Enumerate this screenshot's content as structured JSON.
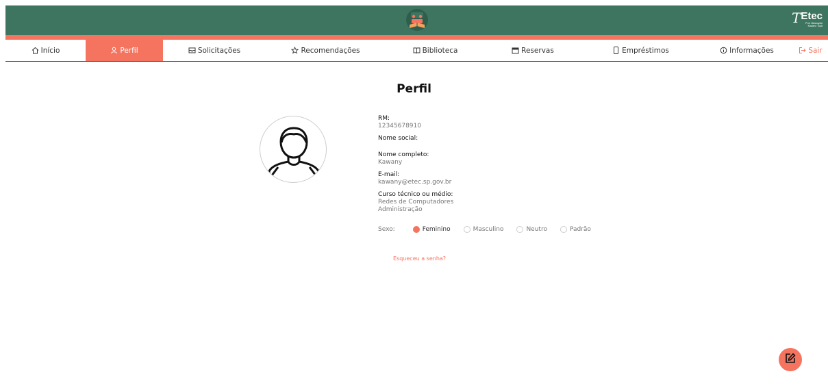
{
  "header": {
    "logo_icon": "library-logo-icon",
    "brand": {
      "mark": "T",
      "name": "Etec",
      "sub1": "Prof. Massuyuki",
      "sub2": "Kawano Tupã"
    }
  },
  "colors": {
    "primary": "#3e7560",
    "accent": "#f5745f"
  },
  "nav": {
    "items": [
      {
        "label": "Início",
        "icon": "home-icon"
      },
      {
        "label": "Perfil",
        "icon": "user-icon",
        "active": true
      },
      {
        "label": "Solicitações",
        "icon": "inbox-icon"
      },
      {
        "label": "Recomendações",
        "icon": "star-icon"
      },
      {
        "label": "Biblioteca",
        "icon": "book-icon"
      },
      {
        "label": "Reservas",
        "icon": "calendar-icon"
      },
      {
        "label": "Empréstimos",
        "icon": "phone-icon"
      },
      {
        "label": "Informações",
        "icon": "info-icon"
      },
      {
        "label": "Sair",
        "icon": "logout-icon"
      }
    ]
  },
  "profile": {
    "title": "Perfil",
    "avatar_icon": "user-avatar-icon",
    "rm_label": "RM:",
    "rm_value": "12345678910",
    "social_name_label": "Nome social:",
    "full_name_label": "Nome completo:",
    "full_name_value": "Kawany",
    "email_label": "E-mail:",
    "email_value": "kawany@etec.sp.gov.br",
    "course_label": "Curso técnico ou médio:",
    "courses": [
      "Redes de Computadores",
      "Administração"
    ],
    "sex_label": "Sexo:",
    "sex_options": [
      {
        "label": "Feminino",
        "checked": true
      },
      {
        "label": "Masculino",
        "checked": false
      },
      {
        "label": "Neutro",
        "checked": false
      },
      {
        "label": "Padrão",
        "checked": false
      }
    ],
    "forgot_password": "Esqueceu a senha?",
    "edit_icon": "edit-icon"
  }
}
